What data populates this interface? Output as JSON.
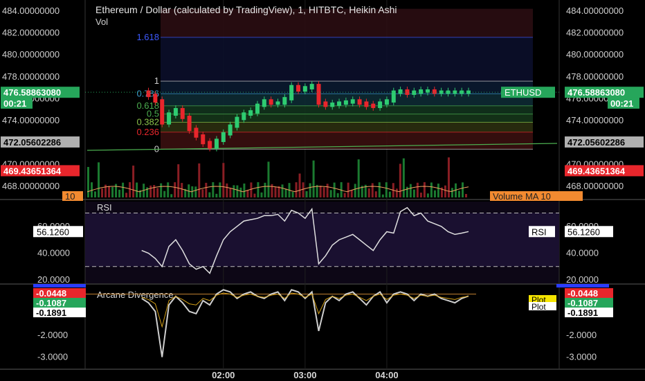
{
  "header": {
    "title": "Ethereum / Dollar (calculated by TradingView), 1, HITBTC, Heikin Ashi",
    "vol_label": "Vol"
  },
  "chart_data": [
    {
      "type": "line",
      "name": "price",
      "y_axis_ticks": [
        "468.00000000",
        "470.00000000",
        "472.00000000",
        "474.00000000",
        "476.00000000",
        "478.00000000",
        "480.00000000",
        "482.00000000",
        "484.00000000"
      ],
      "ylim": [
        467,
        485
      ],
      "time_range_minutes": [
        -40,
        240
      ],
      "price_labels": [
        {
          "text": "476.58863080",
          "value": 476.5886308,
          "color": "#26a65b"
        },
        {
          "text": "00:21",
          "value": 475.6,
          "color": "#26a65b"
        },
        {
          "text": "472.05602286",
          "value": 472.05602286,
          "color": "#b0b0b0"
        },
        {
          "text": "469.43651364",
          "value": 469.43651364,
          "color": "#e8262c"
        }
      ],
      "symbol_tag": "ETHUSD",
      "fib_levels": [
        {
          "label": "0",
          "value": 471.4,
          "color": "#cccccc"
        },
        {
          "label": "0.236",
          "value": 472.95,
          "color": "#e8262c"
        },
        {
          "label": "0.382",
          "value": 473.85,
          "color": "#8bc34a"
        },
        {
          "label": "0.5",
          "value": 474.6,
          "color": "#4caf50"
        },
        {
          "label": "0.618",
          "value": 475.35,
          "color": "#4caf50"
        },
        {
          "label": "0.786",
          "value": 476.45,
          "color": "#3a9dce"
        },
        {
          "label": "1",
          "value": 477.6,
          "color": "#cccccc"
        },
        {
          "label": "1.618",
          "value": 481.6,
          "color": "#3d5afe"
        }
      ],
      "series": [
        {
          "name": "Heikin Ashi",
          "x": [
            0,
            5,
            10,
            15,
            20,
            25,
            30,
            35,
            40,
            45,
            50,
            55,
            60,
            65,
            70,
            75,
            80,
            85,
            90,
            95,
            100,
            105,
            110,
            115,
            120,
            125,
            130,
            135,
            140,
            145,
            150,
            155,
            160,
            165,
            170,
            175,
            180,
            185,
            190,
            195,
            200,
            205,
            210,
            215,
            220,
            225,
            230,
            235,
            240
          ],
          "y": [
            476.6,
            476.3,
            475.8,
            473.8,
            474.6,
            475.0,
            474.3,
            473.2,
            472.6,
            472.0,
            471.6,
            472.2,
            472.8,
            473.5,
            474.2,
            474.6,
            474.8,
            475.4,
            475.8,
            475.6,
            475.6,
            476.0,
            477.1,
            476.8,
            477.0,
            477.2,
            475.6,
            475.4,
            475.5,
            475.6,
            475.7,
            475.8,
            475.6,
            475.4,
            475.3,
            475.6,
            475.8,
            476.6,
            476.7,
            476.5,
            476.6,
            476.7,
            476.7,
            476.6,
            476.6,
            476.6,
            476.6,
            476.6,
            476.6
          ]
        }
      ],
      "volume_ma_label": "Volume MA",
      "volume_ma_value": "10"
    },
    {
      "type": "line",
      "name": "rsi",
      "title": "RSI",
      "y_axis_ticks": [
        "20.0000",
        "40.0000",
        "60.0000"
      ],
      "ylim": [
        18,
        78
      ],
      "bands": [
        30,
        70
      ],
      "value_label": "56.1260",
      "tag": "RSI",
      "series": [
        {
          "name": "RSI",
          "x": [
            0,
            5,
            10,
            15,
            20,
            25,
            30,
            35,
            40,
            45,
            50,
            55,
            60,
            65,
            70,
            75,
            80,
            85,
            90,
            95,
            100,
            105,
            110,
            115,
            120,
            125,
            130,
            135,
            140,
            145,
            150,
            155,
            160,
            165,
            170,
            175,
            180,
            185,
            190,
            195,
            200,
            205,
            210,
            215,
            220,
            225,
            230,
            235,
            240
          ],
          "y": [
            42,
            40,
            36,
            30,
            45,
            50,
            42,
            32,
            28,
            30,
            25,
            38,
            50,
            56,
            60,
            64,
            65,
            66,
            68,
            68,
            69,
            64,
            72,
            70,
            66,
            73,
            32,
            38,
            46,
            50,
            52,
            54,
            50,
            46,
            42,
            50,
            56,
            55,
            71,
            74,
            68,
            70,
            64,
            62,
            60,
            56,
            54,
            55,
            56.126
          ]
        }
      ]
    },
    {
      "type": "line",
      "name": "arcane",
      "title": "Arcane Divergence",
      "y_axis_ticks": [
        "-3.0000",
        "-2.0000",
        "-1.0000",
        "0.0000"
      ],
      "ylim": [
        -3.4,
        0.3
      ],
      "value_labels": [
        {
          "text": "-0.0448",
          "color": "#e8262c"
        },
        {
          "text": "-0.1087",
          "color": "#26a65b"
        },
        {
          "text": "-0.1891",
          "color": "#ffffff"
        }
      ],
      "plot_tags": [
        "Plot",
        "Plot"
      ],
      "series": [
        {
          "name": "Plot",
          "x": [
            0,
            5,
            10,
            15,
            20,
            25,
            30,
            35,
            40,
            45,
            50,
            55,
            60,
            65,
            70,
            75,
            80,
            85,
            90,
            95,
            100,
            105,
            110,
            115,
            120,
            125,
            130,
            135,
            140,
            145,
            150,
            155,
            160,
            165,
            170,
            175,
            180,
            185,
            190,
            195,
            200,
            205,
            210,
            215,
            220,
            225,
            230,
            235,
            240
          ],
          "y": [
            -0.3,
            -0.5,
            -0.9,
            -3.0,
            -0.6,
            -0.2,
            -0.5,
            -0.9,
            -1.0,
            -0.4,
            -0.6,
            -0.1,
            0.1,
            0.0,
            -0.3,
            -0.1,
            0.0,
            -0.2,
            -0.3,
            -0.1,
            0.0,
            -0.4,
            0.1,
            0.0,
            -0.3,
            0.0,
            -1.8,
            -0.5,
            -0.2,
            -0.4,
            -0.1,
            0.0,
            -0.3,
            -0.6,
            -0.2,
            0.0,
            -0.5,
            -0.1,
            0.0,
            -0.1,
            -0.4,
            -0.1,
            -0.2,
            -0.1,
            -0.3,
            -0.4,
            -0.5,
            -0.3,
            -0.1891
          ]
        }
      ]
    }
  ],
  "x_axis": {
    "ticks": [
      {
        "label": "02:00",
        "minute": 60
      },
      {
        "label": "03:00",
        "minute": 120
      },
      {
        "label": "04:00",
        "minute": 180
      }
    ]
  }
}
